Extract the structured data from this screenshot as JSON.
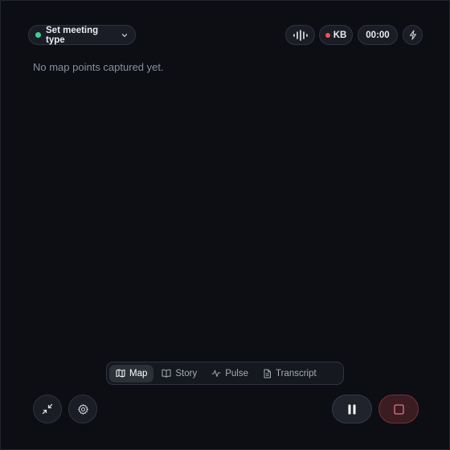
{
  "header": {
    "meeting_type_label": "Set meeting type",
    "meeting_status_color": "#3ed28a",
    "recorder_initials": "KB",
    "recording_color": "#ef5350",
    "timer": "00:00",
    "icons": [
      "audio-wave-icon",
      "lightning-icon",
      "chevron-down-icon"
    ]
  },
  "main": {
    "empty_message": "No map points captured yet."
  },
  "tabs": [
    {
      "label": "Map",
      "icon": "map-icon",
      "active": true
    },
    {
      "label": "Story",
      "icon": "book-icon",
      "active": false
    },
    {
      "label": "Pulse",
      "icon": "pulse-icon",
      "active": false
    },
    {
      "label": "Transcript",
      "icon": "document-icon",
      "active": false
    }
  ],
  "controls": {
    "left": [
      "minimize-icon",
      "gear-icon"
    ],
    "right": [
      "pause-icon",
      "stop-icon"
    ],
    "stop_color": "#e0757f"
  }
}
